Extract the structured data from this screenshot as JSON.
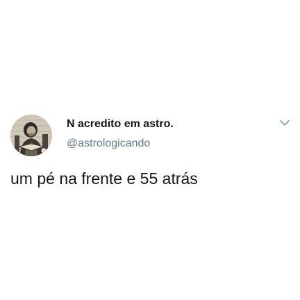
{
  "tweet": {
    "author": {
      "display_name": "N acredito em astro.",
      "handle": "@astrologicando",
      "avatar_icon": "engraving-portrait-avatar"
    },
    "menu_icon": "chevron-down-icon",
    "text": "um pé na frente e 55 atrás"
  },
  "colors": {
    "background": "#ffffff",
    "primary_text": "#14171a",
    "secondary_text": "#657786",
    "chevron": "#8899a6"
  }
}
